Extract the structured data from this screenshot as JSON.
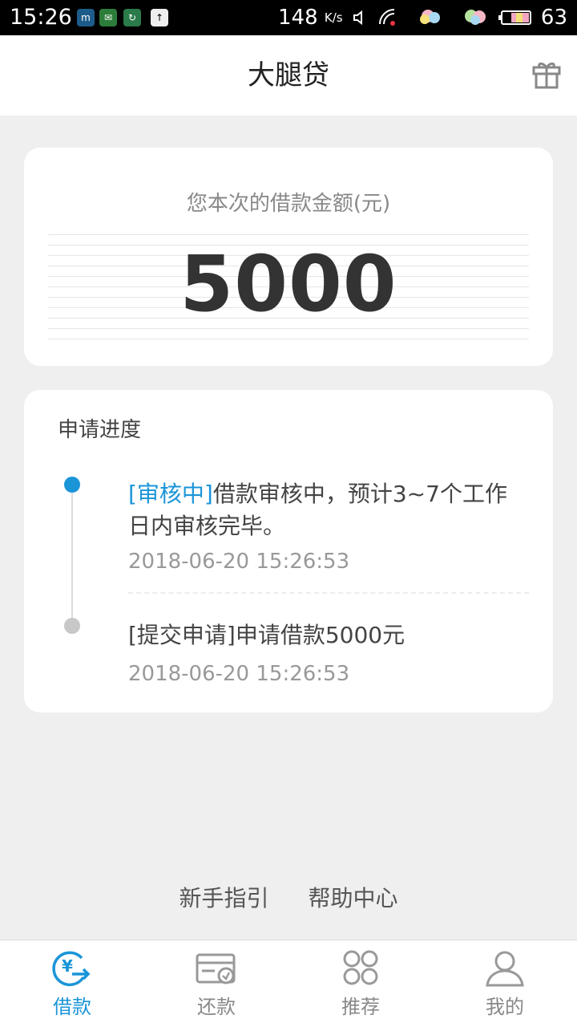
{
  "status_bar": {
    "time": "15:26",
    "speed": "148",
    "speed_unit": "K/s",
    "battery": "63",
    "app_icons": [
      "m-app-icon",
      "wechat-icon",
      "sync-app-icon",
      "upload-icon"
    ]
  },
  "header": {
    "title": "大腿贷",
    "gift_icon": "gift-icon"
  },
  "amount": {
    "label": "您本次的借款金额(元)",
    "value": "5000"
  },
  "progress": {
    "title": "申请进度",
    "steps": [
      {
        "tag": "[审核中]",
        "text": "借款审核中，预计3~7个工作日内审核完毕。",
        "time": "2018-06-20 15:26:53"
      },
      {
        "tag": "[提交申请]",
        "text": "申请借款5000元",
        "time": "2018-06-20 15:26:53"
      }
    ]
  },
  "help": {
    "guide": "新手指引",
    "center": "帮助中心"
  },
  "nav": {
    "items": [
      {
        "label": "借款",
        "icon": "loan-icon",
        "active": true
      },
      {
        "label": "还款",
        "icon": "repay-icon",
        "active": false
      },
      {
        "label": "推荐",
        "icon": "recommend-icon",
        "active": false
      },
      {
        "label": "我的",
        "icon": "profile-icon",
        "active": false
      }
    ]
  },
  "colors": {
    "accent": "#1a95d8",
    "background": "#efefef"
  }
}
